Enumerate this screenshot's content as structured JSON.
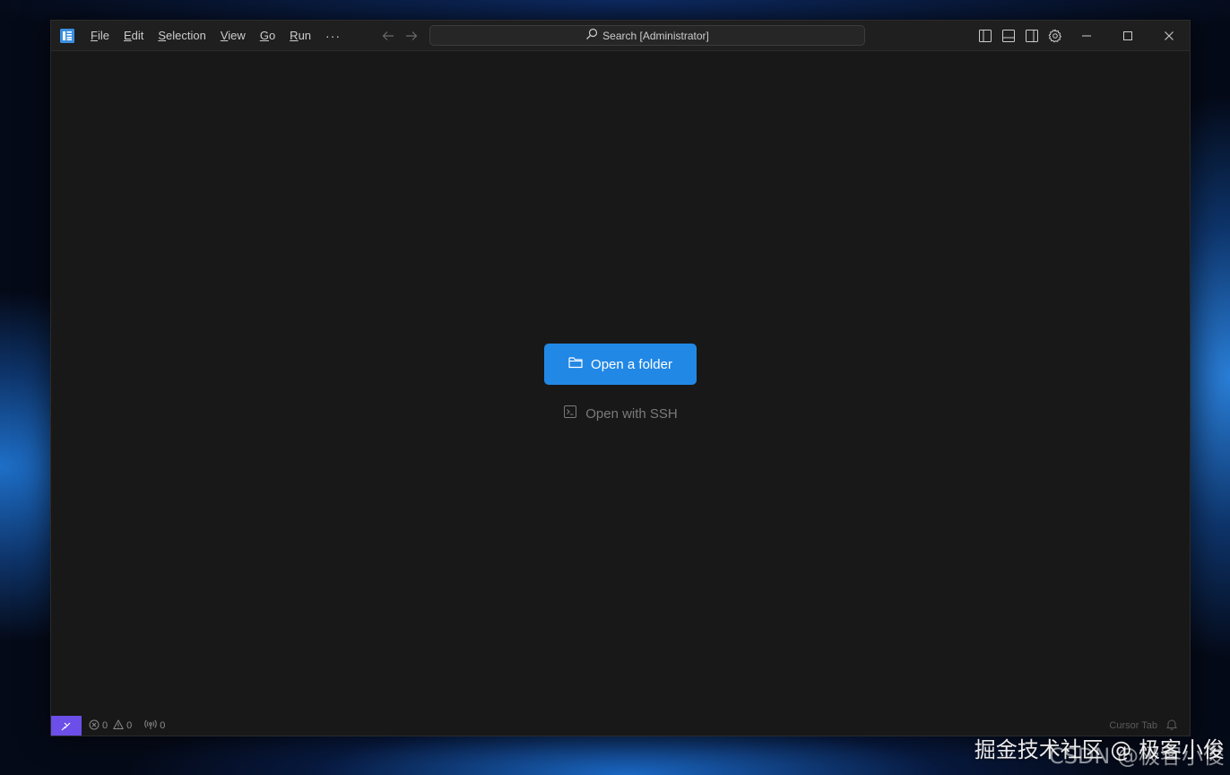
{
  "titlebar": {
    "menu": [
      {
        "mnemonic": "F",
        "rest": "ile"
      },
      {
        "mnemonic": "E",
        "rest": "dit"
      },
      {
        "mnemonic": "S",
        "rest": "election"
      },
      {
        "mnemonic": "V",
        "rest": "iew"
      },
      {
        "mnemonic": "G",
        "rest": "o"
      },
      {
        "mnemonic": "R",
        "rest": "un"
      }
    ],
    "more": "···",
    "search_text": "Search [Administrator]"
  },
  "welcome": {
    "open_folder_label": "Open a folder",
    "open_ssh_label": "Open with SSH"
  },
  "statusbar": {
    "errors": "0",
    "warnings": "0",
    "ports": "0",
    "cursor_tab": "Cursor Tab"
  },
  "watermark": {
    "line1": "掘金技术社区 @ 极客小俊",
    "line2": "CSDN @极客小俊"
  },
  "colors": {
    "accent": "#2188e6",
    "remote": "#6c4ee8",
    "editor_bg": "#181818"
  }
}
